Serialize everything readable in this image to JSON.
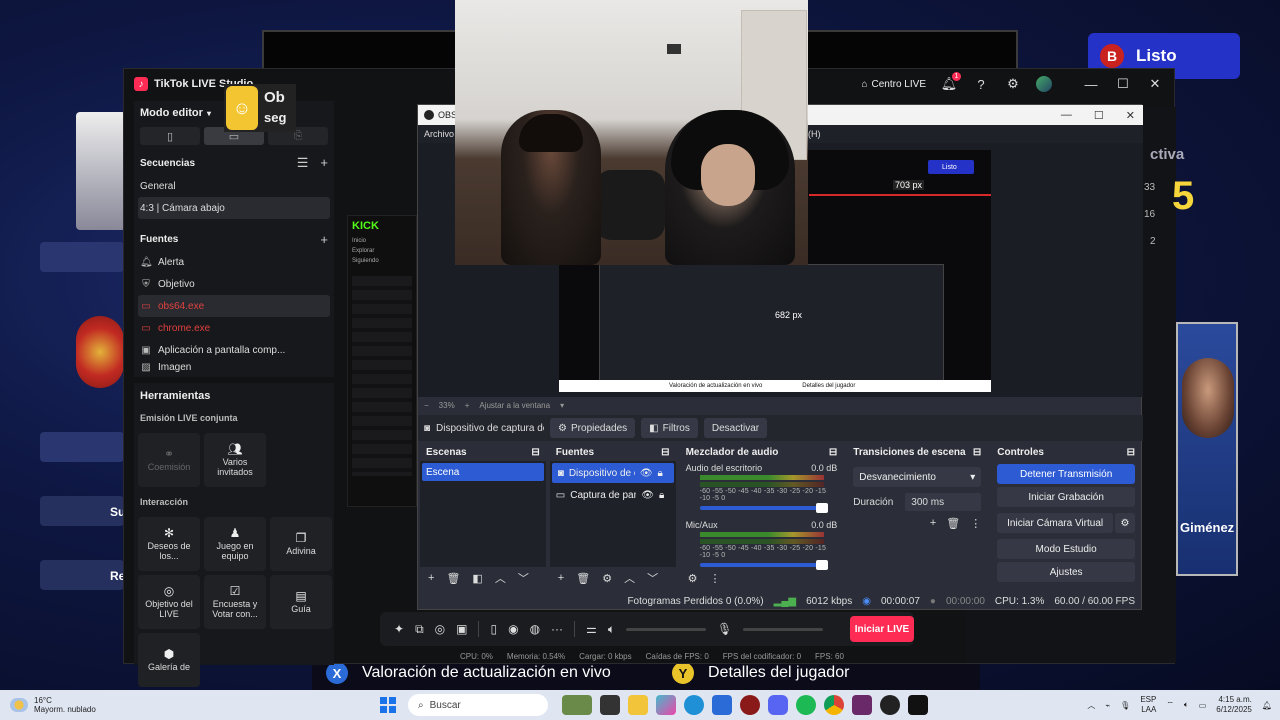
{
  "background": {
    "listo_badge": "B",
    "listo_label": "Listo",
    "ticker": [
      {
        "key": "X",
        "label": "Valoración de actualización en vivo",
        "color": "#2a6bd8"
      },
      {
        "key": "Y",
        "label": "Detalles del jugador",
        "color": "#e8c32a"
      }
    ],
    "right_fragments": {
      "activa": "ctiva",
      "big_num": "5",
      "player_name": "Giménez",
      "nums": [
        "33",
        "16",
        "2"
      ]
    }
  },
  "tiktok": {
    "title": "TikTok LIVE Studio",
    "centro_live": "Centro LIVE",
    "notif_count": "1",
    "mode_editor": "Modo editor",
    "secuencias_label": "Secuencias",
    "secuencias": [
      "General",
      "4:3 | Cámara abajo"
    ],
    "fuentes_label": "Fuentes",
    "fuentes": [
      {
        "label": "Alerta",
        "icon": "bell-icon",
        "state": "normal"
      },
      {
        "label": "Objetivo",
        "icon": "shield-icon",
        "state": "normal"
      },
      {
        "label": "obs64.exe",
        "icon": "window-icon",
        "state": "error"
      },
      {
        "label": "chrome.exe",
        "icon": "window-icon",
        "state": "error"
      },
      {
        "label": "Aplicación a pantalla comp...",
        "icon": "app-icon",
        "state": "normal"
      },
      {
        "label": "Imagen",
        "icon": "image-icon",
        "state": "normal"
      }
    ],
    "herramientas_label": "Herramientas",
    "emision_label": "Emisión LIVE conjunta",
    "emision_tools": [
      {
        "label": "Coemisión",
        "icon": "link-icon",
        "disabled": true
      },
      {
        "label": "Varios invitados",
        "icon": "users-icon",
        "disabled": false
      }
    ],
    "interaccion_label": "Interacción",
    "interaccion_tools": [
      {
        "label": "Deseos de los...",
        "icon": "gift-icon"
      },
      {
        "label": "Juego en equipo",
        "icon": "team-icon"
      },
      {
        "label": "Adivina",
        "icon": "question-icon"
      },
      {
        "label": "Objetivo del LIVE",
        "icon": "target-icon"
      },
      {
        "label": "Encuesta y Votar con...",
        "icon": "vote-icon"
      },
      {
        "label": "Guía",
        "icon": "guide-icon"
      },
      {
        "label": "Galería de",
        "icon": "gallery-icon"
      }
    ],
    "start_live": "Iniciar LIVE",
    "stats": {
      "cpu": "CPU: 0%",
      "memoria": "Memoria: 0.54%",
      "cargar": "Cargar: 0 kbps",
      "caidas": "Caídas de FPS: 0",
      "fps_cod": "FPS del codificador: 0",
      "fps": "FPS: 60"
    }
  },
  "preview_left": {
    "obj_title": "Ob",
    "obj_sub": "seg",
    "kick_logo": "KICK",
    "kick_items": [
      "Inicio",
      "Explorar",
      "Siguiendo"
    ]
  },
  "obs": {
    "title": "OBS",
    "menu_first": "Archivo",
    "menu_help": "(H)",
    "zoom": "33%",
    "fit": "Ajustar a la ventana",
    "source_name": "Dispositivo de captura de v",
    "props": "Propiedades",
    "filters": "Filtros",
    "deactivate": "Desactivar",
    "docks": {
      "scenes": "Escenas",
      "sources": "Fuentes",
      "mixer": "Mezclador de audio",
      "transitions": "Transiciones de escena",
      "controls": "Controles"
    },
    "scenes": [
      "Escena"
    ],
    "sources": [
      "Dispositivo de ca",
      "Captura de pant"
    ],
    "mixer": [
      {
        "name": "Audio del escritorio",
        "db": "0.0 dB"
      },
      {
        "name": "Mic/Aux",
        "db": "0.0 dB"
      }
    ],
    "meter_scale": "-60 -55 -50 -45 -40 -35 -30 -25 -20 -15 -10 -5 0",
    "transition": "Desvanecimiento",
    "duration_label": "Duración",
    "duration": "300 ms",
    "controls": [
      {
        "label": "Detener Transmisión",
        "primary": true
      },
      {
        "label": "Iniciar Grabación",
        "primary": false
      },
      {
        "label": "Iniciar Cámara Virtual",
        "primary": false
      },
      {
        "label": "Modo Estudio",
        "primary": false
      },
      {
        "label": "Ajustes",
        "primary": false
      }
    ],
    "status": {
      "dropped": "Fotogramas Perdidos 0 (0.0%)",
      "kbps": "6012 kbps",
      "live_time": "00:00:07",
      "rec_time": "00:00:00",
      "cpu": "CPU: 1.3%",
      "fps": "60.00 / 60.00 FPS"
    }
  },
  "nested": {
    "px1": "703 px",
    "px2": "682 px",
    "listo": "Listo",
    "tick1": "Valoración de actualización en vivo",
    "tick2": "Detalles del jugador"
  },
  "taskbar": {
    "temp": "16°C",
    "weather": "Mayorm. nublado",
    "search": "Buscar",
    "lang1": "ESP",
    "lang2": "LAA",
    "time": "4:15 a.m.",
    "date": "6/12/2025"
  }
}
